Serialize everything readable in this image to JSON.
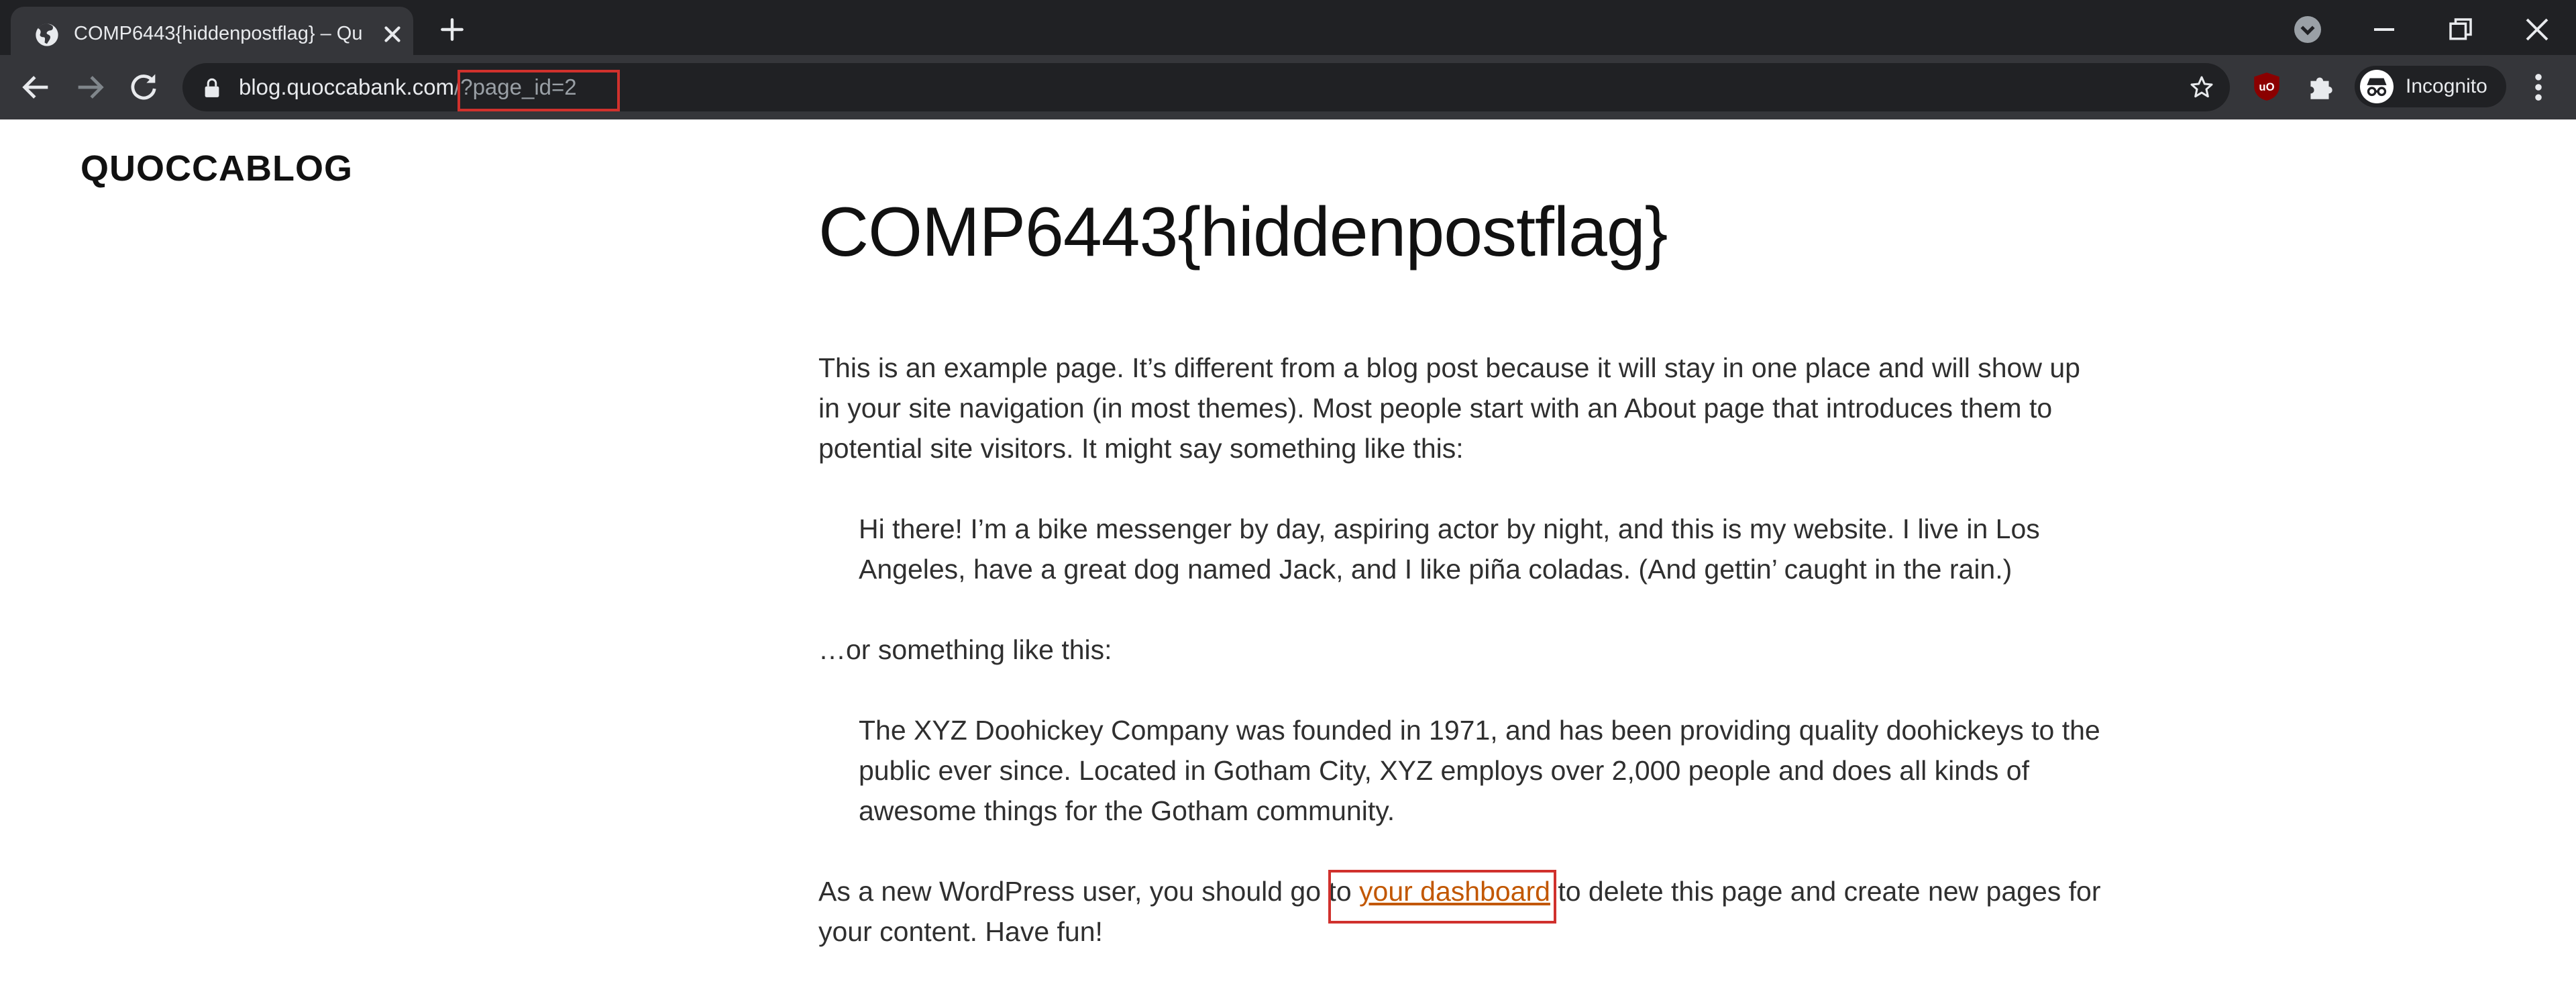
{
  "browser": {
    "tab": {
      "title": "COMP6443{hiddenpostflag} – Qu"
    },
    "address_bar": {
      "host": "blog.quoccabank.com",
      "path": "/?page_id=2"
    },
    "profile": {
      "label": "Incognito"
    },
    "colors": {
      "tabstrip": "#202124",
      "toolbar": "#35363a",
      "annotation": "#d0312d"
    }
  },
  "page": {
    "site_title": "QUOCCABLOG",
    "title": "COMP6443{hiddenpostflag}",
    "paragraph1": "This is an example page. It’s different from a blog post because it will stay in one place and will show up in your site navigation (in most themes). Most people start with an About page that introduces them to potential site visitors. It might say something like this:",
    "quote1": "Hi there! I’m a bike messenger by day, aspiring actor by night, and this is my website. I live in Los Angeles, have a great dog named Jack, and I like piña coladas. (And gettin’ caught in the rain.)",
    "paragraph2": "…or something like this:",
    "quote2": "The XYZ Doohickey Company was founded in 1971, and has been providing quality doohickeys to the public ever since. Located in Gotham City, XYZ employs over 2,000 people and does all kinds of awesome things for the Gotham community.",
    "paragraph3_before": "As a new WordPress user, you should go to ",
    "paragraph3_link": "your dashboard",
    "paragraph3_after": " to delete this page and create new pages for your content. Have fun!",
    "link_color": "#c25700"
  }
}
